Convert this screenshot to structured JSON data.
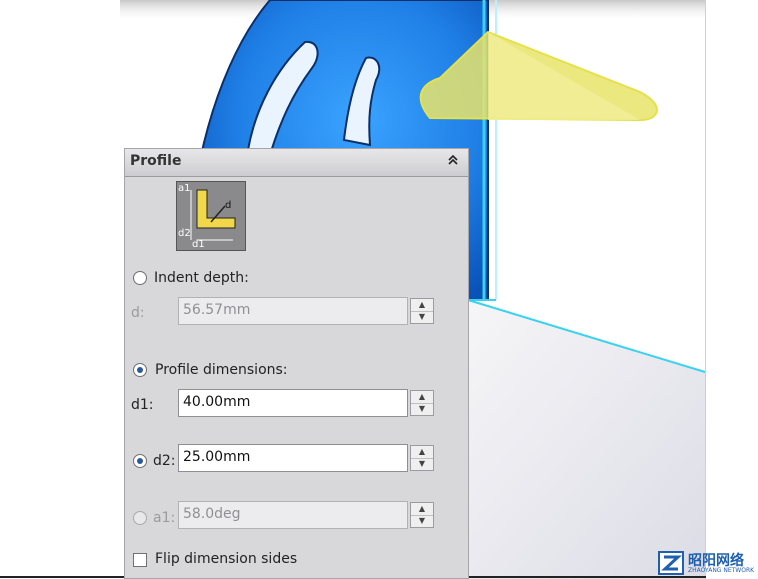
{
  "panel": {
    "title": "Profile",
    "collapse_icon": "double-chevron-up-icon",
    "image_labels": {
      "a1": "a1",
      "d": "d",
      "d2": "d2",
      "d1": "d1"
    },
    "indent_depth": {
      "label": "Indent depth:",
      "checked": false,
      "d_label": "d:",
      "value": "56.57mm",
      "enabled": false
    },
    "profile_dimensions": {
      "label": "Profile dimensions:",
      "checked": true,
      "d1_label": "d1:",
      "d1_value": "40.00mm",
      "d2_label": "d2:",
      "d2_checked": true,
      "d2_value": "25.00mm",
      "a1_label": "a1:",
      "a1_checked": false,
      "a1_value": "58.0deg",
      "a1_enabled": false
    },
    "flip": {
      "label": "Flip dimension sides",
      "checked": false
    }
  },
  "watermark": {
    "text": "昭阳网络",
    "subtext": "ZHAOYANG NETWORK"
  },
  "colors": {
    "model_blue": "#1f7fe6",
    "highlight_yellow": "#e6e04a",
    "edge_cyan": "#39d2f0"
  }
}
